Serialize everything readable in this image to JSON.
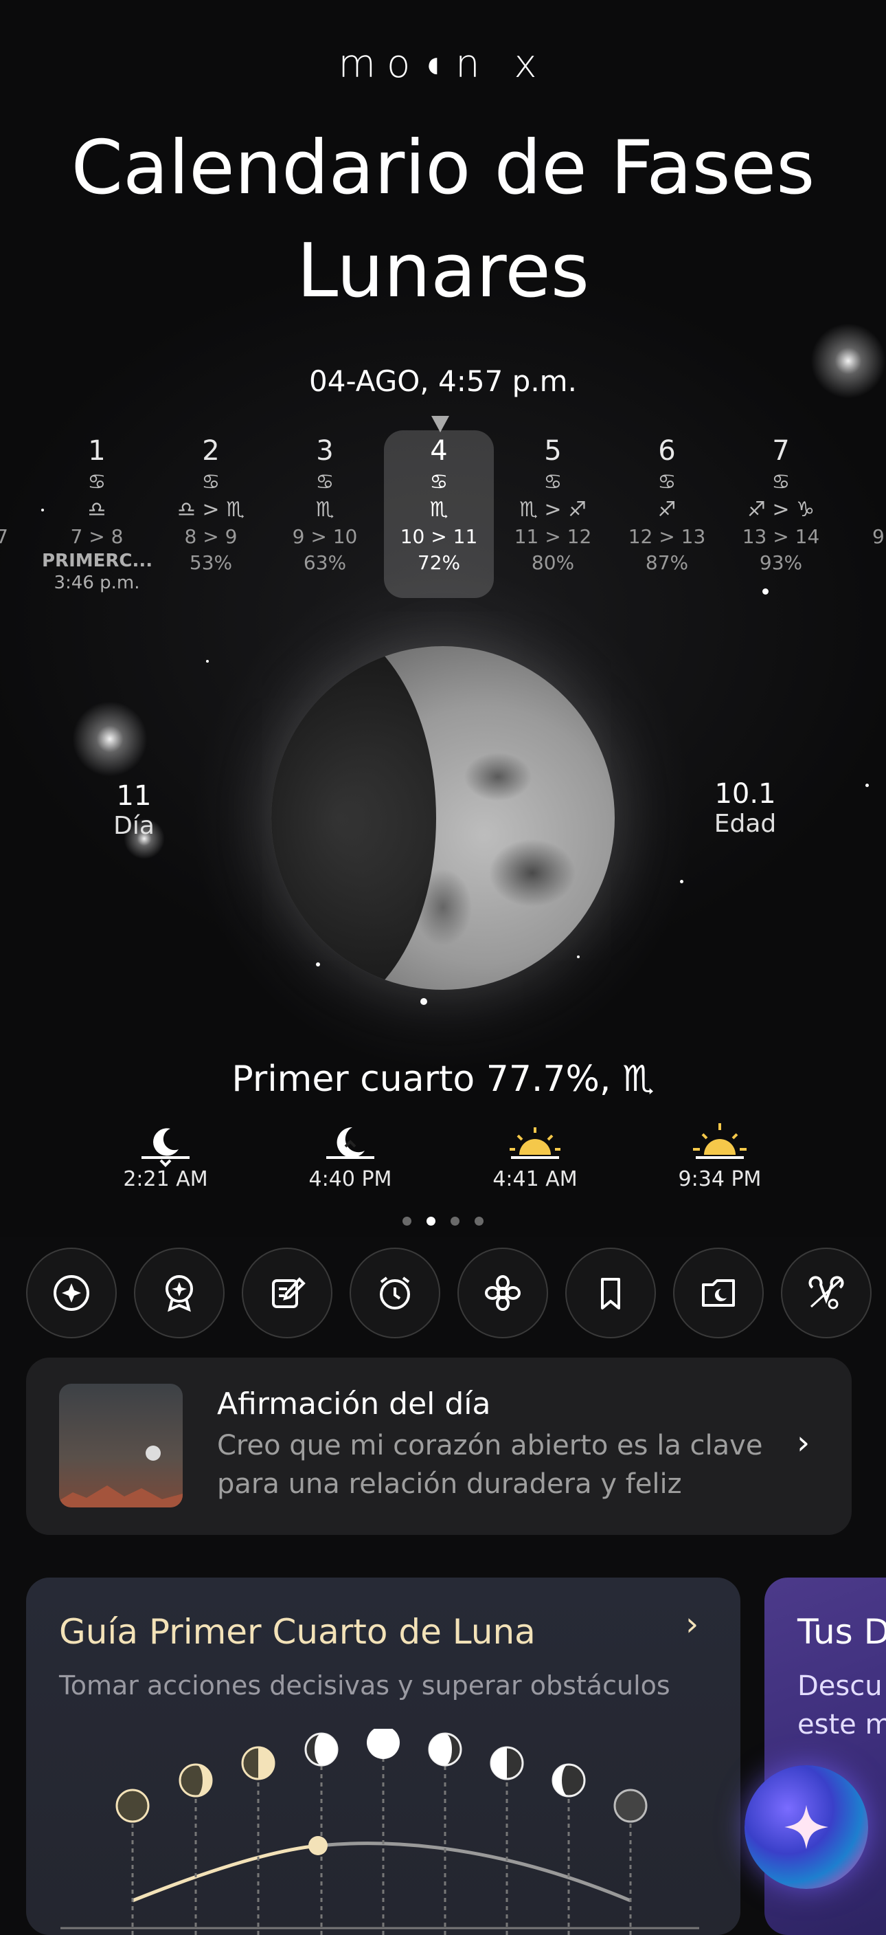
{
  "app": {
    "logo": "mo◖n x",
    "title": "Calendario de Fases Lunares"
  },
  "current": {
    "datetime": "04-AGO, 4:57 p.m."
  },
  "calendar": {
    "partial_left": {
      "sym1": "♎",
      "rng": "7"
    },
    "days": [
      {
        "num": "1",
        "sym1": "♋",
        "sym2": "♎",
        "range": "7 > 8",
        "pct": "",
        "extra1": "PRIMERC...",
        "extra2": "3:46 p.m."
      },
      {
        "num": "2",
        "sym1": "♋",
        "sym2": "♎ > ♏",
        "range": "8 > 9",
        "pct": "53%",
        "extra1": "",
        "extra2": ""
      },
      {
        "num": "3",
        "sym1": "♋",
        "sym2": "♏",
        "range": "9 > 10",
        "pct": "63%",
        "extra1": "",
        "extra2": ""
      },
      {
        "num": "4",
        "sym1": "♋",
        "sym2": "♏",
        "range": "10 > 11",
        "pct": "72%",
        "extra1": "",
        "extra2": ""
      },
      {
        "num": "5",
        "sym1": "♋",
        "sym2": "♏ > ♐",
        "range": "11 > 12",
        "pct": "80%",
        "extra1": "",
        "extra2": ""
      },
      {
        "num": "6",
        "sym1": "♋",
        "sym2": "♐",
        "range": "12 > 13",
        "pct": "87%",
        "extra1": "",
        "extra2": ""
      },
      {
        "num": "7",
        "sym1": "♋",
        "sym2": "♐ > ♑",
        "range": "13 > 14",
        "pct": "93%",
        "extra1": "",
        "extra2": ""
      }
    ],
    "partial_right": {
      "rng": "9"
    }
  },
  "moon_stats": {
    "day": {
      "value": "11",
      "label": "Día"
    },
    "age": {
      "value": "10.1",
      "label": "Edad"
    }
  },
  "phase": {
    "text": "Primer cuarto 77.7%, ♏"
  },
  "rise_set": [
    {
      "icon": "moonrise-icon",
      "time": "2:21 AM"
    },
    {
      "icon": "moonset-icon",
      "time": "4:40 PM"
    },
    {
      "icon": "sunrise-icon",
      "time": "4:41 AM"
    },
    {
      "icon": "sunset-icon",
      "time": "9:34 PM"
    }
  ],
  "pager": {
    "count": 4,
    "active": 1
  },
  "tools": [
    "compass-star-icon",
    "badge-star-icon",
    "journal-edit-icon",
    "alarm-clock-icon",
    "flower-icon",
    "bookmark-icon",
    "moon-folder-icon",
    "zodiac-icon"
  ],
  "affirmation": {
    "title": "Afirmación del día",
    "text": "Creo que mi corazón abierto es la clave para una relación duradera y feliz"
  },
  "guide": {
    "title": "Guía Primer Cuarto de Luna",
    "subtitle": "Tomar acciones decisivas y superar obstáculos"
  },
  "card2": {
    "title": "Tus D",
    "line1": "Descu",
    "line2": "este m"
  },
  "colors": {
    "accent_gold": "#f3e2b8",
    "sun_yellow": "#f5c84a",
    "card2_purple": "#4c3a8a"
  }
}
